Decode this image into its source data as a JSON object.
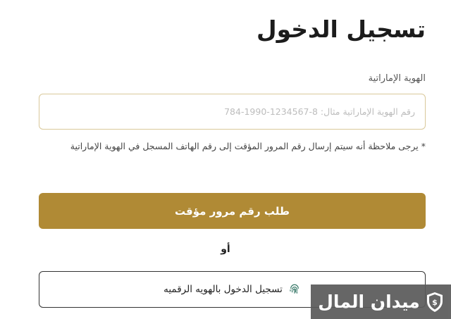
{
  "page": {
    "title": "تسجيل الدخول"
  },
  "emirates_id": {
    "label": "الهوية الإماراتية",
    "placeholder": "رقم الهوية الإماراتية مثال: 8-1234567-1990-784",
    "value": ""
  },
  "note": "* يرجى ملاحظة أنه سيتم إرسال رقم المرور المؤقت إلى رقم الهاتف المسجل في الهوية الإماراتية",
  "otp_button": {
    "label": "طلب رقم مرور مؤقت"
  },
  "separator": "أو",
  "uaepass_button": {
    "label": "تسجيل الدخول بالهويه الرقميه",
    "icon": "fingerprint-icon"
  },
  "watermark": {
    "text": "ميدان المال",
    "icon": "shield-icon"
  },
  "colors": {
    "accent": "#b08a35",
    "input_border": "#d9c89a",
    "watermark_bg": "#5a5a5a"
  }
}
